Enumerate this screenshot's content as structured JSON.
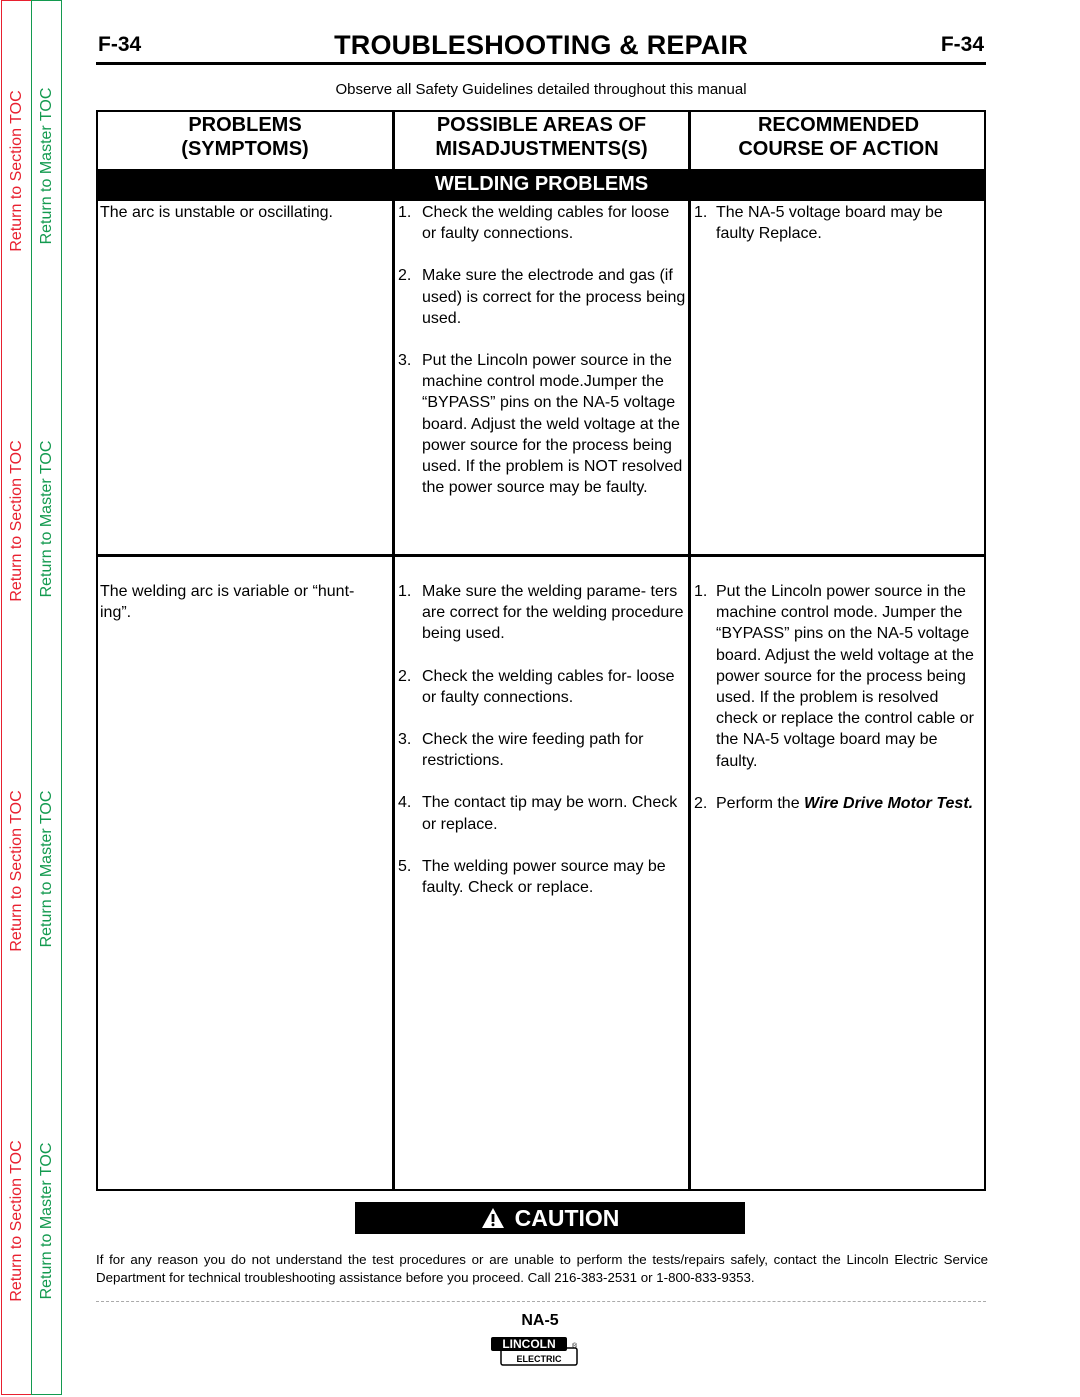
{
  "sidebar": {
    "section_toc_label": "Return to Section TOC",
    "master_toc_label": "Return to Master TOC",
    "colors": {
      "section": "#e8202f",
      "master": "#139a4f"
    }
  },
  "header": {
    "page_number_left": "F-34",
    "title": "TROUBLESHOOTING & REPAIR",
    "page_number_right": "F-34",
    "safety_note": "Observe all Safety Guidelines detailed throughout this manual"
  },
  "table": {
    "columns": [
      {
        "line1": "PROBLEMS",
        "line2": "(SYMPTOMS)"
      },
      {
        "line1": "POSSIBLE AREAS OF",
        "line2": "MISADJUSTMENTS(S)"
      },
      {
        "line1": "RECOMMENDED",
        "line2": "COURSE OF ACTION"
      }
    ],
    "section_band": "WELDING PROBLEMS",
    "rows": [
      {
        "problem": "The arc is unstable or oscillating.",
        "misadjustments": [
          {
            "num": "1.",
            "text": "Check the welding cables for loose or faulty connections."
          },
          {
            "num": "2.",
            "text": "Make sure the electrode and gas (if used) is correct for the process being used."
          },
          {
            "num": "3.",
            "text": "Put the Lincoln power source in the machine control mode.Jumper the “BYPASS” pins on the NA-5 voltage board. Adjust the weld voltage at the power source for the process being used.  If the problem is NOT resolved the power source may be faulty."
          }
        ],
        "actions": [
          {
            "num": "1.",
            "text": "The NA-5 voltage board may be faulty Replace."
          }
        ]
      },
      {
        "problem": "The welding arc is variable or “hunt- ing”.",
        "misadjustments": [
          {
            "num": "1.",
            "text": "Make sure the welding parame- ters are correct for the welding procedure being used."
          },
          {
            "num": "2.",
            "text": "Check the welding cables for- loose or faulty connections."
          },
          {
            "num": "3.",
            "text": "Check the wire feeding path for restrictions."
          },
          {
            "num": "4.",
            "text": "The contact tip may be worn. Check or replace."
          },
          {
            "num": "5.",
            "text": "The welding power source may be faulty. Check or replace."
          }
        ],
        "actions": [
          {
            "num": "1.",
            "text": "Put the Lincoln power source in the machine control mode. Jumper the “BYPASS” pins on the NA-5 voltage board.  Adjust the weld voltage at the power source for the process being used.  If the problem is resolved check or replace the control cable or the NA-5 voltage board may be faulty."
          },
          {
            "num": "2.",
            "text_prefix": "Perform the ",
            "text_emphasis": "Wire Drive Motor Test."
          }
        ]
      }
    ]
  },
  "caution": {
    "label": "CAUTION",
    "icon": "warning-triangle-icon",
    "message": "If for any reason you do not understand the test procedures or are unable to perform the tests/repairs safely, contact the Lincoln Electric Service Department for technical troubleshooting assistance before you proceed. Call 216-383-2531 or 1-800-833-9353."
  },
  "footer": {
    "model": "NA-5",
    "logo_top": "LINCOLN",
    "logo_bottom": "ELECTRIC",
    "logo_mark": "®"
  }
}
